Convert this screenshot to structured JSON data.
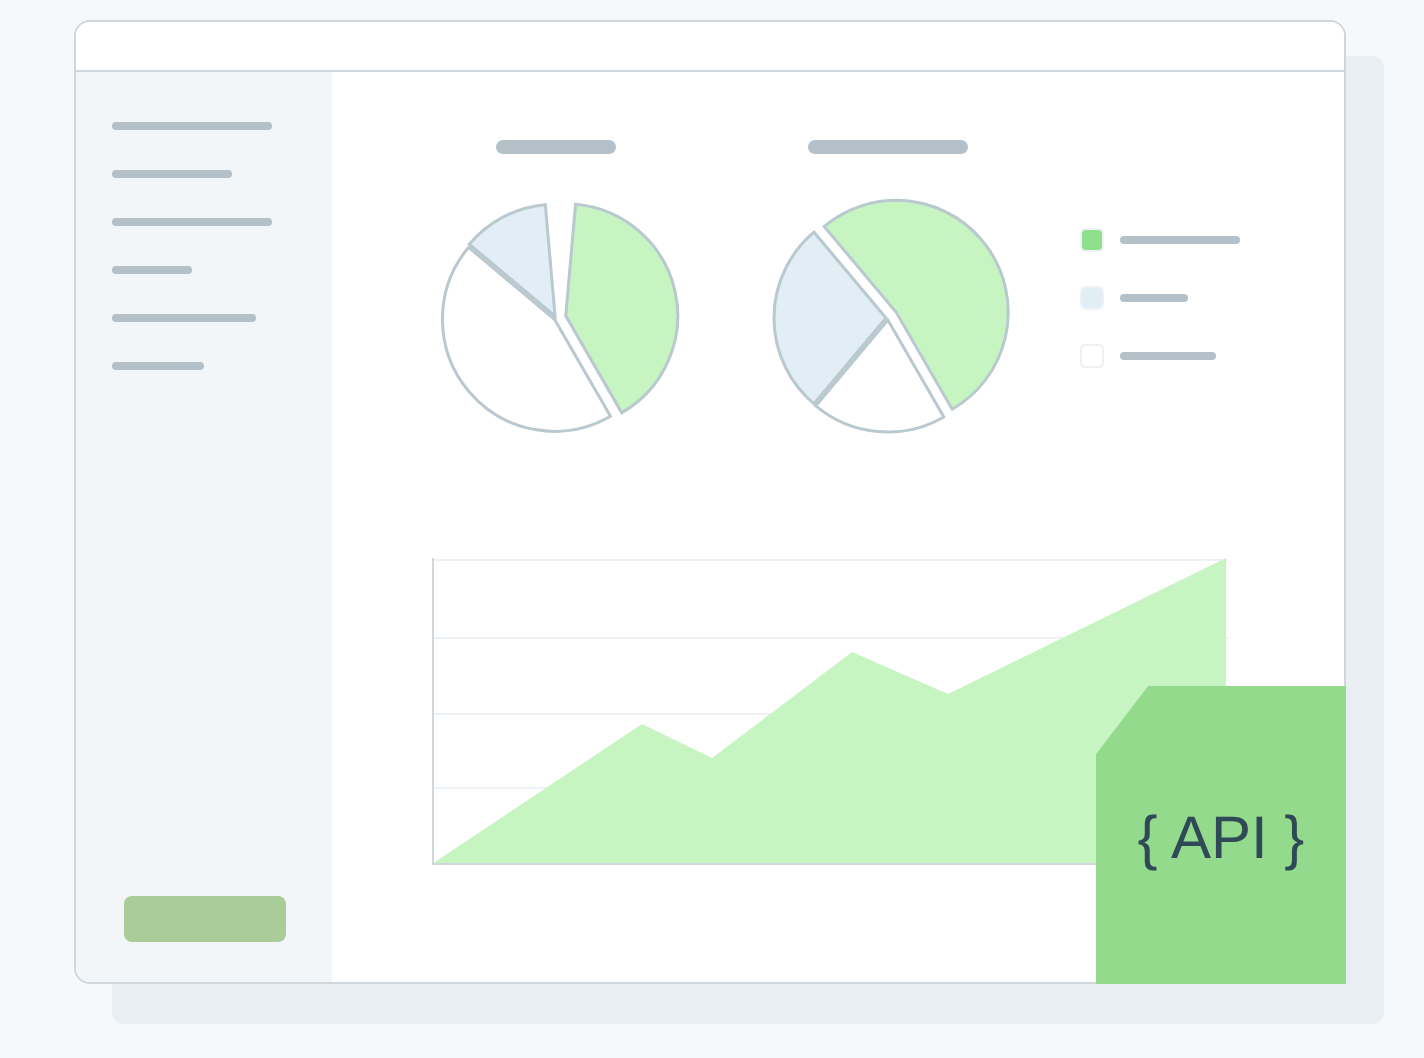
{
  "legend": [
    {
      "color": "#8fe08a"
    },
    {
      "color": "#e1eef6"
    },
    {
      "color": "#ffffff"
    }
  ],
  "badge": {
    "text": "{ API }"
  }
}
